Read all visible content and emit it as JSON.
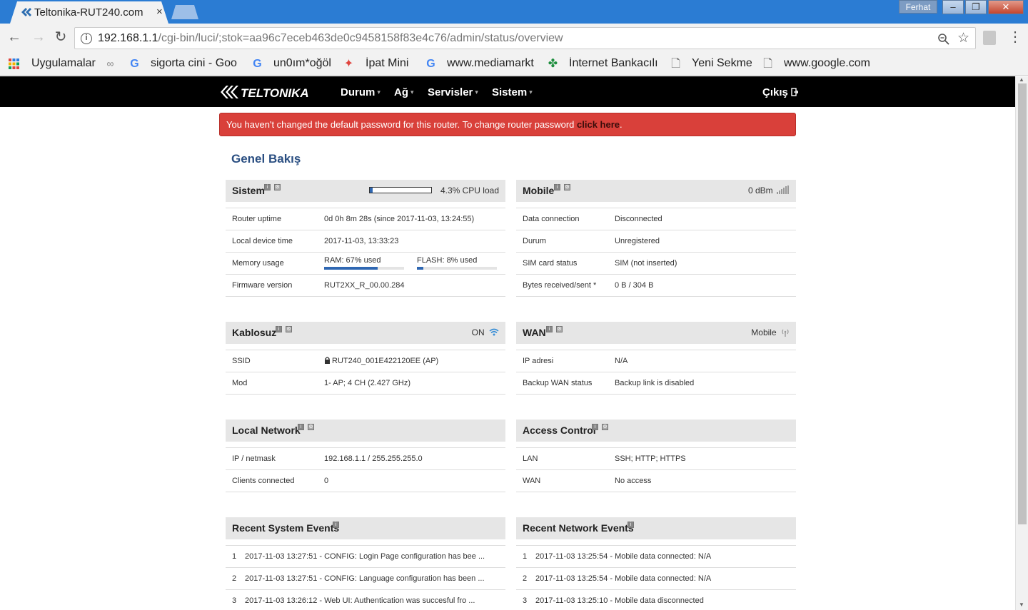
{
  "browser": {
    "tab_title": "Teltonika-RUT240.com",
    "tab_close": "×",
    "profile_name": "Ferhat",
    "url_host": "192.168.1.1",
    "url_path": "/cgi-bin/luci/;stok=aa96c7eceb463de0c9458158f83e4c76/admin/status/overview",
    "bookmarks": [
      {
        "label": "Uygulamalar",
        "icon": "apps-grid-icon"
      },
      {
        "label": "",
        "icon": "binoculars-icon"
      },
      {
        "label": "sigorta cini - Goo",
        "icon": "google-icon"
      },
      {
        "label": "un0ım*oğöl",
        "icon": "google-icon"
      },
      {
        "label": "İpat Mini",
        "icon": "star-cross-icon"
      },
      {
        "label": "www.mediamarkt",
        "icon": "google-icon"
      },
      {
        "label": "İnternet Bankacılı",
        "icon": "clover-icon"
      },
      {
        "label": "Yeni Sekme",
        "icon": "page-icon"
      },
      {
        "label": "www.google.com",
        "icon": "page-icon"
      }
    ]
  },
  "nav": {
    "brand": "TELTONIKA",
    "items": [
      "Durum",
      "Ağ",
      "Servisler",
      "Sistem"
    ],
    "logout": "Çıkış"
  },
  "alert": {
    "text": "You haven't changed the default password for this router. To change router password ",
    "link": "click here",
    "tail": "."
  },
  "page_title": "Genel Bakış",
  "panels": {
    "sistem": {
      "title": "Sistem",
      "cpu_fraction": 0.043,
      "cpu_text": "4.3% CPU load",
      "rows": [
        {
          "k": "Router uptime",
          "v": "0d 0h 8m 28s (since 2017-11-03, 13:24:55)"
        },
        {
          "k": "Local device time",
          "v": "2017-11-03, 13:33:23"
        },
        {
          "k": "Memory usage",
          "v": ""
        },
        {
          "k": "Firmware version",
          "v": "RUT2XX_R_00.00.284"
        }
      ],
      "ram_label": "RAM: 67% used",
      "ram_fraction": 0.67,
      "flash_label": "FLASH: 8% used",
      "flash_fraction": 0.08
    },
    "mobile": {
      "title": "Mobile",
      "signal_text": "0 dBm",
      "rows": [
        {
          "k": "Data connection",
          "v": "Disconnected"
        },
        {
          "k": "Durum",
          "v": "Unregistered"
        },
        {
          "k": "SIM card status",
          "v": "SIM (not inserted)"
        },
        {
          "k": "Bytes received/sent *",
          "v": "0 B / 304 B"
        }
      ]
    },
    "kablosuz": {
      "title": "Kablosuz",
      "status": "ON",
      "rows": [
        {
          "k": "SSID",
          "v": "RUT240_001E422120EE (AP)"
        },
        {
          "k": "Mod",
          "v": "1- AP; 4 CH (2.427 GHz)"
        }
      ]
    },
    "wan": {
      "title": "WAN",
      "status": "Mobile",
      "rows": [
        {
          "k": "IP adresi",
          "v": "N/A"
        },
        {
          "k": "Backup WAN status",
          "v": "Backup link is disabled"
        }
      ]
    },
    "local_network": {
      "title": "Local Network",
      "rows": [
        {
          "k": "IP / netmask",
          "v": "192.168.1.1 / 255.255.255.0"
        },
        {
          "k": "Clients connected",
          "v": "0"
        }
      ]
    },
    "access_control": {
      "title": "Access Control",
      "rows": [
        {
          "k": "LAN",
          "v": "SSH; HTTP; HTTPS"
        },
        {
          "k": "WAN",
          "v": "No access"
        }
      ]
    },
    "system_events": {
      "title": "Recent System Events",
      "rows": [
        {
          "n": "1",
          "t": "2017-11-03 13:27:51 - CONFIG: Login Page configuration has bee ..."
        },
        {
          "n": "2",
          "t": "2017-11-03 13:27:51 - CONFIG: Language configuration has been ..."
        },
        {
          "n": "3",
          "t": "2017-11-03 13:26:12 - Web UI: Authentication was succesful fro ..."
        }
      ]
    },
    "network_events": {
      "title": "Recent Network Events",
      "rows": [
        {
          "n": "1",
          "t": "2017-11-03 13:25:54 - Mobile data connected: N/A"
        },
        {
          "n": "2",
          "t": "2017-11-03 13:25:54 - Mobile data connected: N/A"
        },
        {
          "n": "3",
          "t": "2017-11-03 13:25:10 - Mobile data disconnected"
        }
      ]
    }
  }
}
